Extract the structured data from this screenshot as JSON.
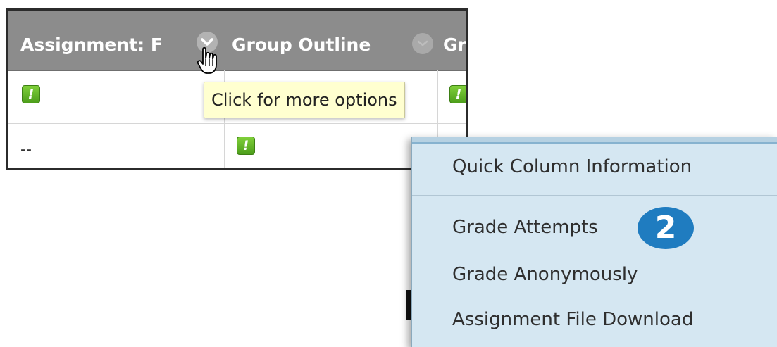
{
  "grid": {
    "columns": [
      {
        "title": "Assignment: F"
      },
      {
        "title": "Group Outline"
      },
      {
        "title": "Gr"
      }
    ],
    "rows": [
      {
        "cells": [
          "!",
          "",
          "!"
        ]
      },
      {
        "cells": [
          "--",
          "!",
          ""
        ]
      }
    ]
  },
  "tooltip": {
    "text": "Click for more options"
  },
  "menu": {
    "items": [
      {
        "label": "Quick Column Information"
      },
      {
        "label": "Grade Attempts"
      },
      {
        "label": "Grade Anonymously"
      },
      {
        "label": "Assignment File Download"
      }
    ],
    "step_badge": "2"
  },
  "colors": {
    "header_bg": "#8c8c8c",
    "menu_bg": "#d5e7f2",
    "badge_blue": "#1f7cc0",
    "needs_grading_green": "#5fb02a",
    "tooltip_bg": "#ffffd0"
  },
  "icons": {
    "chevron": "chevron-down-icon",
    "needs_grading": "exclamation-icon",
    "cursor": "hand-pointer-icon"
  }
}
